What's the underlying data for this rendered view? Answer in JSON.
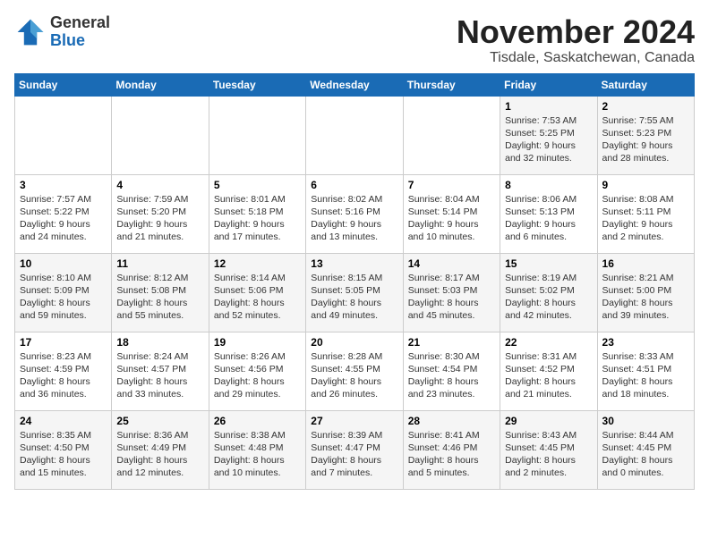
{
  "logo": {
    "general": "General",
    "blue": "Blue"
  },
  "title": "November 2024",
  "location": "Tisdale, Saskatchewan, Canada",
  "days_of_week": [
    "Sunday",
    "Monday",
    "Tuesday",
    "Wednesday",
    "Thursday",
    "Friday",
    "Saturday"
  ],
  "weeks": [
    [
      {
        "day": "",
        "info": ""
      },
      {
        "day": "",
        "info": ""
      },
      {
        "day": "",
        "info": ""
      },
      {
        "day": "",
        "info": ""
      },
      {
        "day": "",
        "info": ""
      },
      {
        "day": "1",
        "info": "Sunrise: 7:53 AM\nSunset: 5:25 PM\nDaylight: 9 hours\nand 32 minutes."
      },
      {
        "day": "2",
        "info": "Sunrise: 7:55 AM\nSunset: 5:23 PM\nDaylight: 9 hours\nand 28 minutes."
      }
    ],
    [
      {
        "day": "3",
        "info": "Sunrise: 7:57 AM\nSunset: 5:22 PM\nDaylight: 9 hours\nand 24 minutes."
      },
      {
        "day": "4",
        "info": "Sunrise: 7:59 AM\nSunset: 5:20 PM\nDaylight: 9 hours\nand 21 minutes."
      },
      {
        "day": "5",
        "info": "Sunrise: 8:01 AM\nSunset: 5:18 PM\nDaylight: 9 hours\nand 17 minutes."
      },
      {
        "day": "6",
        "info": "Sunrise: 8:02 AM\nSunset: 5:16 PM\nDaylight: 9 hours\nand 13 minutes."
      },
      {
        "day": "7",
        "info": "Sunrise: 8:04 AM\nSunset: 5:14 PM\nDaylight: 9 hours\nand 10 minutes."
      },
      {
        "day": "8",
        "info": "Sunrise: 8:06 AM\nSunset: 5:13 PM\nDaylight: 9 hours\nand 6 minutes."
      },
      {
        "day": "9",
        "info": "Sunrise: 8:08 AM\nSunset: 5:11 PM\nDaylight: 9 hours\nand 2 minutes."
      }
    ],
    [
      {
        "day": "10",
        "info": "Sunrise: 8:10 AM\nSunset: 5:09 PM\nDaylight: 8 hours\nand 59 minutes."
      },
      {
        "day": "11",
        "info": "Sunrise: 8:12 AM\nSunset: 5:08 PM\nDaylight: 8 hours\nand 55 minutes."
      },
      {
        "day": "12",
        "info": "Sunrise: 8:14 AM\nSunset: 5:06 PM\nDaylight: 8 hours\nand 52 minutes."
      },
      {
        "day": "13",
        "info": "Sunrise: 8:15 AM\nSunset: 5:05 PM\nDaylight: 8 hours\nand 49 minutes."
      },
      {
        "day": "14",
        "info": "Sunrise: 8:17 AM\nSunset: 5:03 PM\nDaylight: 8 hours\nand 45 minutes."
      },
      {
        "day": "15",
        "info": "Sunrise: 8:19 AM\nSunset: 5:02 PM\nDaylight: 8 hours\nand 42 minutes."
      },
      {
        "day": "16",
        "info": "Sunrise: 8:21 AM\nSunset: 5:00 PM\nDaylight: 8 hours\nand 39 minutes."
      }
    ],
    [
      {
        "day": "17",
        "info": "Sunrise: 8:23 AM\nSunset: 4:59 PM\nDaylight: 8 hours\nand 36 minutes."
      },
      {
        "day": "18",
        "info": "Sunrise: 8:24 AM\nSunset: 4:57 PM\nDaylight: 8 hours\nand 33 minutes."
      },
      {
        "day": "19",
        "info": "Sunrise: 8:26 AM\nSunset: 4:56 PM\nDaylight: 8 hours\nand 29 minutes."
      },
      {
        "day": "20",
        "info": "Sunrise: 8:28 AM\nSunset: 4:55 PM\nDaylight: 8 hours\nand 26 minutes."
      },
      {
        "day": "21",
        "info": "Sunrise: 8:30 AM\nSunset: 4:54 PM\nDaylight: 8 hours\nand 23 minutes."
      },
      {
        "day": "22",
        "info": "Sunrise: 8:31 AM\nSunset: 4:52 PM\nDaylight: 8 hours\nand 21 minutes."
      },
      {
        "day": "23",
        "info": "Sunrise: 8:33 AM\nSunset: 4:51 PM\nDaylight: 8 hours\nand 18 minutes."
      }
    ],
    [
      {
        "day": "24",
        "info": "Sunrise: 8:35 AM\nSunset: 4:50 PM\nDaylight: 8 hours\nand 15 minutes."
      },
      {
        "day": "25",
        "info": "Sunrise: 8:36 AM\nSunset: 4:49 PM\nDaylight: 8 hours\nand 12 minutes."
      },
      {
        "day": "26",
        "info": "Sunrise: 8:38 AM\nSunset: 4:48 PM\nDaylight: 8 hours\nand 10 minutes."
      },
      {
        "day": "27",
        "info": "Sunrise: 8:39 AM\nSunset: 4:47 PM\nDaylight: 8 hours\nand 7 minutes."
      },
      {
        "day": "28",
        "info": "Sunrise: 8:41 AM\nSunset: 4:46 PM\nDaylight: 8 hours\nand 5 minutes."
      },
      {
        "day": "29",
        "info": "Sunrise: 8:43 AM\nSunset: 4:45 PM\nDaylight: 8 hours\nand 2 minutes."
      },
      {
        "day": "30",
        "info": "Sunrise: 8:44 AM\nSunset: 4:45 PM\nDaylight: 8 hours\nand 0 minutes."
      }
    ]
  ]
}
